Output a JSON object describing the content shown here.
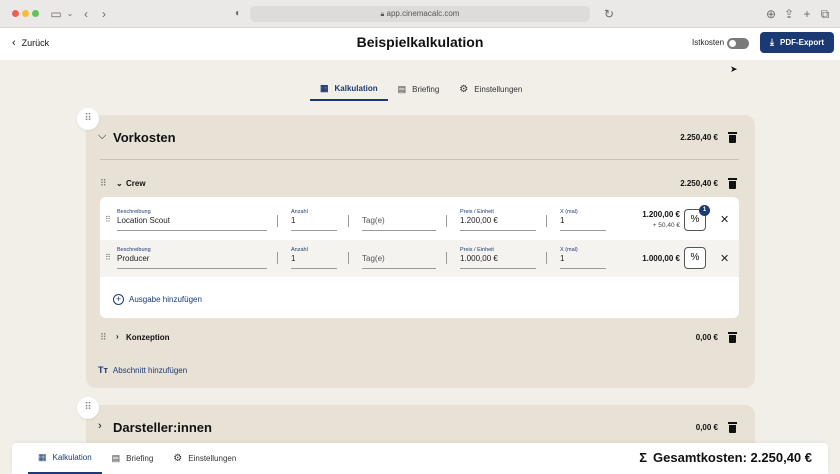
{
  "browser": {
    "url": "app.cinemacalc.com"
  },
  "header": {
    "back_label": "Zurück",
    "title": "Beispielkalkulation",
    "istkosten_label": "Istkosten",
    "pdf_label": "PDF-Export"
  },
  "tabs": [
    {
      "label": "Kalkulation"
    },
    {
      "label": "Briefing"
    },
    {
      "label": "Einstellungen"
    }
  ],
  "sections": [
    {
      "title": "Vorkosten",
      "sum": "2.250,40 €",
      "subsections": [
        {
          "title": "Crew",
          "sum": "2.250,40 €",
          "rows": [
            {
              "beschreibung_label": "Beschreibung",
              "beschreibung": "Location Scout",
              "anzahl_label": "Anzahl",
              "anzahl": "1",
              "einheit": "Tag(e)",
              "preis_label": "Preis / Einheit",
              "preis": "1.200,00 €",
              "x_label": "X (mal)",
              "x": "1",
              "total": "1.200,00 €",
              "extra": "+ 50,40 €",
              "badge": "1"
            },
            {
              "beschreibung_label": "Beschreibung",
              "beschreibung": "Producer",
              "anzahl_label": "Anzahl",
              "anzahl": "1",
              "einheit": "Tag(e)",
              "preis_label": "Preis / Einheit",
              "preis": "1.000,00 €",
              "x_label": "X (mal)",
              "x": "1",
              "total": "1.000,00 €"
            }
          ],
          "add_label": "Ausgabe hinzufügen"
        },
        {
          "title": "Konzeption",
          "sum": "0,00 €"
        }
      ],
      "add_section_label": "Abschnitt hinzufügen"
    },
    {
      "title": "Darsteller:innen",
      "sum": "0,00 €"
    }
  ],
  "bottom": {
    "tabs": [
      {
        "label": "Kalkulation"
      },
      {
        "label": "Briefing"
      },
      {
        "label": "Einstellungen"
      }
    ],
    "total_symbol": "Σ",
    "total_label": "Gesamtkosten: 2.250,40 €"
  },
  "colors": {
    "brand": "#1b3a73",
    "page_bg": "#f2efe9",
    "section_bg": "#e8e1d6"
  }
}
